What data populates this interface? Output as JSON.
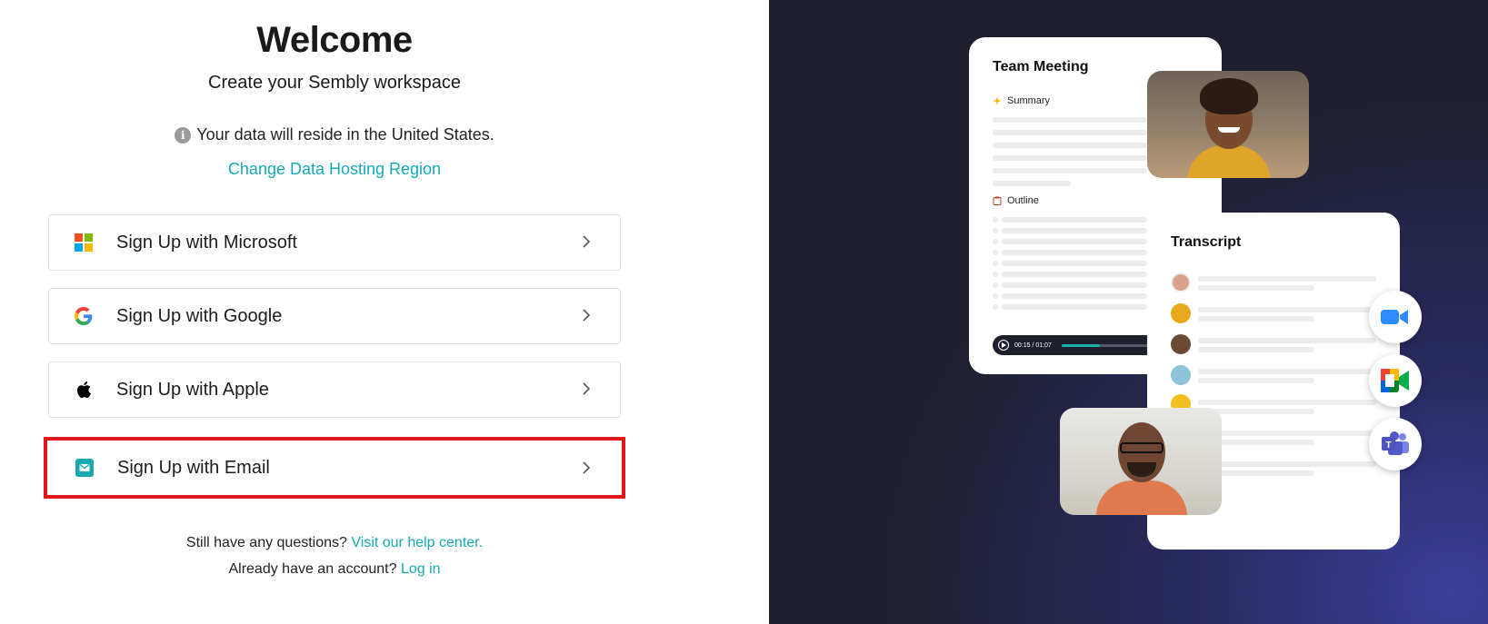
{
  "header": {
    "title": "Welcome",
    "subtitle": "Create your Sembly workspace",
    "residency_text": "Your data will reside in the United States.",
    "change_region_link": "Change Data Hosting Region"
  },
  "signup_options": {
    "microsoft": {
      "label": "Sign Up with Microsoft",
      "icon": "microsoft-logo-icon"
    },
    "google": {
      "label": "Sign Up with Google",
      "icon": "google-logo-icon"
    },
    "apple": {
      "label": "Sign Up with Apple",
      "icon": "apple-logo-icon"
    },
    "email": {
      "label": "Sign Up with Email",
      "icon": "email-icon",
      "highlighted": true,
      "highlight_color": "#e3181b"
    }
  },
  "footer": {
    "help_prefix": "Still have any questions?",
    "help_link": "Visit our help center.",
    "login_prefix": "Already have an account?",
    "login_link": "Log in"
  },
  "illustration": {
    "meeting_card": {
      "title": "Team Meeting",
      "summary_label": "Summary",
      "outline_label": "Outline",
      "player_time": "00:15 / 01:07",
      "progress": 0.38
    },
    "transcript_card": {
      "title": "Transcript"
    },
    "integrations": [
      "zoom-icon",
      "google-meet-icon",
      "microsoft-teams-icon"
    ]
  },
  "colors": {
    "accent": "#16a9b3",
    "right_panel_bg": "#1e1f2d",
    "highlight": "#e3181b"
  }
}
